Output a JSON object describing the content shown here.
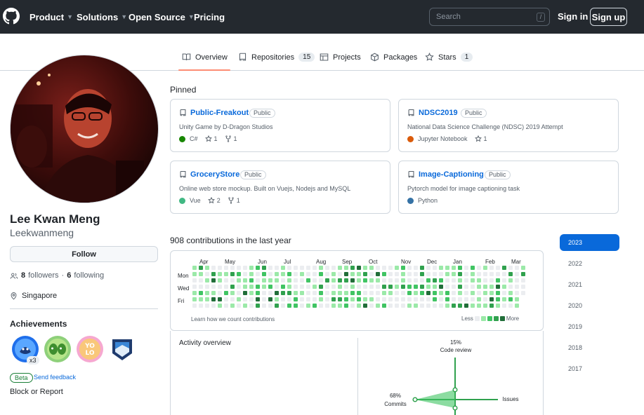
{
  "header": {
    "nav": [
      {
        "label": "Product",
        "has_dropdown": true
      },
      {
        "label": "Solutions",
        "has_dropdown": true
      },
      {
        "label": "Open Source",
        "has_dropdown": true
      },
      {
        "label": "Pricing",
        "has_dropdown": false
      }
    ],
    "search_placeholder": "Search",
    "search_shortcut": "/",
    "signin": "Sign in",
    "signup": "Sign up"
  },
  "tabs": [
    {
      "label": "Overview",
      "icon": "book-icon",
      "count": null,
      "active": true
    },
    {
      "label": "Repositories",
      "icon": "repo-icon",
      "count": "15"
    },
    {
      "label": "Projects",
      "icon": "table-icon",
      "count": null
    },
    {
      "label": "Packages",
      "icon": "package-icon",
      "count": null
    },
    {
      "label": "Stars",
      "icon": "star-icon",
      "count": "1"
    }
  ],
  "profile": {
    "name": "Lee Kwan Meng",
    "login": "Leekwanmeng",
    "follow": "Follow",
    "followers_count": "8",
    "followers_label": "followers",
    "separator": "·",
    "following_count": "6",
    "following_label": "following",
    "location": "Singapore",
    "achievements_title": "Achievements",
    "achievement_multiplier": "x3",
    "beta": "Beta",
    "feedback": "Send feedback",
    "block": "Block or Report"
  },
  "pinned": {
    "title": "Pinned",
    "repos": [
      {
        "name": "Public-Freakout",
        "visibility": "Public",
        "description": "Unity Game by D-Dragon Studios",
        "language": "C#",
        "lang_color": "#178600",
        "stars": "1",
        "forks": "1"
      },
      {
        "name": "NDSC2019",
        "visibility": "Public",
        "description": "National Data Science Challenge (NDSC) 2019 Attempt",
        "language": "Jupyter Notebook",
        "lang_color": "#DA5B0B",
        "stars": "1",
        "forks": null
      },
      {
        "name": "GroceryStore",
        "visibility": "Public",
        "description": "Online web store mockup. Built on Vuejs, Nodejs and MySQL",
        "language": "Vue",
        "lang_color": "#41b883",
        "stars": "2",
        "forks": "1"
      },
      {
        "name": "Image-Captioning",
        "visibility": "Public",
        "description": "Pytorch model for image captioning task",
        "language": "Python",
        "lang_color": "#3572A5",
        "stars": null,
        "forks": null
      }
    ]
  },
  "contributions": {
    "title": "908 contributions in the last year",
    "months": [
      "Apr",
      "May",
      "Jun",
      "Jul",
      "Aug",
      "Sep",
      "Oct",
      "Nov",
      "Dec",
      "Jan",
      "Feb",
      "Mar"
    ],
    "days": [
      "Mon",
      "Wed",
      "Fri"
    ],
    "learn": "Learn how we count contributions",
    "less": "Less",
    "more": "More",
    "colors": [
      "#ebedf0",
      "#9be9a8",
      "#40c463",
      "#30a14e",
      "#216e39"
    ]
  },
  "years": [
    "2023",
    "2022",
    "2021",
    "2020",
    "2019",
    "2018",
    "2017"
  ],
  "activity": {
    "title": "Activity overview",
    "code_review_pct": "15%",
    "code_review": "Code review",
    "commits_pct": "68%",
    "commits": "Commits",
    "issues": "Issues"
  }
}
